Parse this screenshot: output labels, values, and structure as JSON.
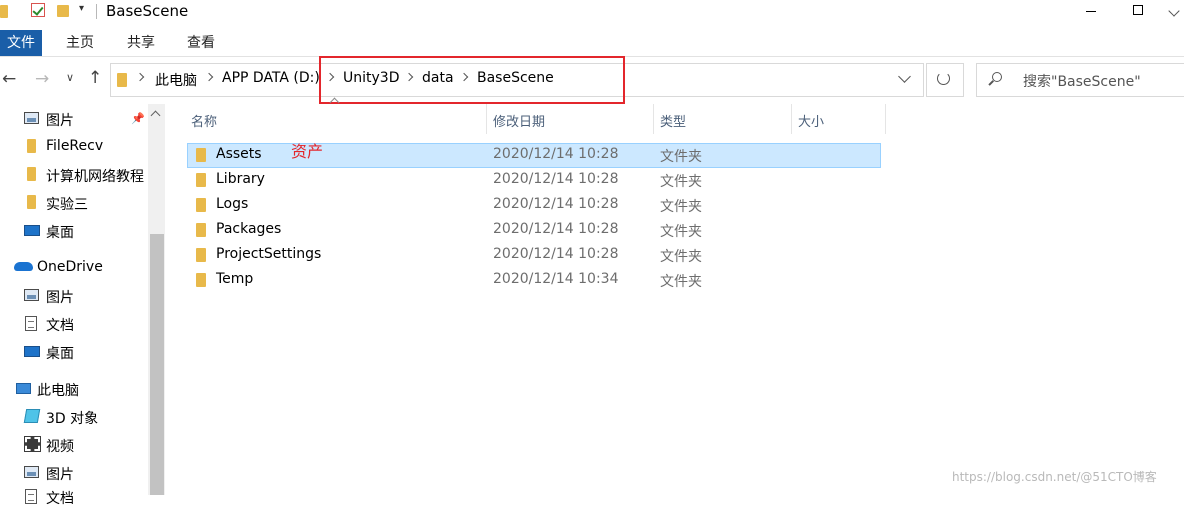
{
  "window": {
    "title": "BaseScene"
  },
  "ribbon": {
    "tabs": [
      "文件",
      "主页",
      "共享",
      "查看"
    ]
  },
  "address": {
    "crumbs": [
      "此电脑",
      "APP DATA (D:)",
      "Unity3D",
      "data",
      "BaseScene"
    ]
  },
  "search": {
    "placeholder": "搜索\"BaseScene\""
  },
  "sidebar": {
    "items": [
      {
        "label": "图片",
        "icon": "pictures-icon"
      },
      {
        "label": "FileRecv",
        "icon": "folder-icon"
      },
      {
        "label": "计算机网络教程",
        "icon": "folder-icon"
      },
      {
        "label": "实验三",
        "icon": "folder-icon"
      },
      {
        "label": "桌面",
        "icon": "desktop-icon"
      },
      {
        "label": "OneDrive",
        "icon": "onedrive-icon"
      },
      {
        "label": "图片",
        "icon": "pictures-icon"
      },
      {
        "label": "文档",
        "icon": "documents-icon"
      },
      {
        "label": "桌面",
        "icon": "desktop-icon"
      },
      {
        "label": "此电脑",
        "icon": "this-pc-icon"
      },
      {
        "label": "3D 对象",
        "icon": "3d-objects-icon"
      },
      {
        "label": "视频",
        "icon": "videos-icon"
      },
      {
        "label": "图片",
        "icon": "pictures-icon"
      },
      {
        "label": "文档",
        "icon": "documents-icon"
      }
    ]
  },
  "columns": {
    "name": "名称",
    "modified": "修改日期",
    "type": "类型",
    "size": "大小"
  },
  "files": [
    {
      "name": "Assets",
      "modified": "2020/12/14 10:28",
      "type": "文件夹",
      "selected": true
    },
    {
      "name": "Library",
      "modified": "2020/12/14 10:28",
      "type": "文件夹"
    },
    {
      "name": "Logs",
      "modified": "2020/12/14 10:28",
      "type": "文件夹"
    },
    {
      "name": "Packages",
      "modified": "2020/12/14 10:28",
      "type": "文件夹"
    },
    {
      "name": "ProjectSettings",
      "modified": "2020/12/14 10:28",
      "type": "文件夹"
    },
    {
      "name": "Temp",
      "modified": "2020/12/14 10:34",
      "type": "文件夹"
    }
  ],
  "annotation": {
    "label": "资产",
    "color": "#e3262c"
  },
  "watermark": "https://blog.csdn.net/@51CTO博客"
}
